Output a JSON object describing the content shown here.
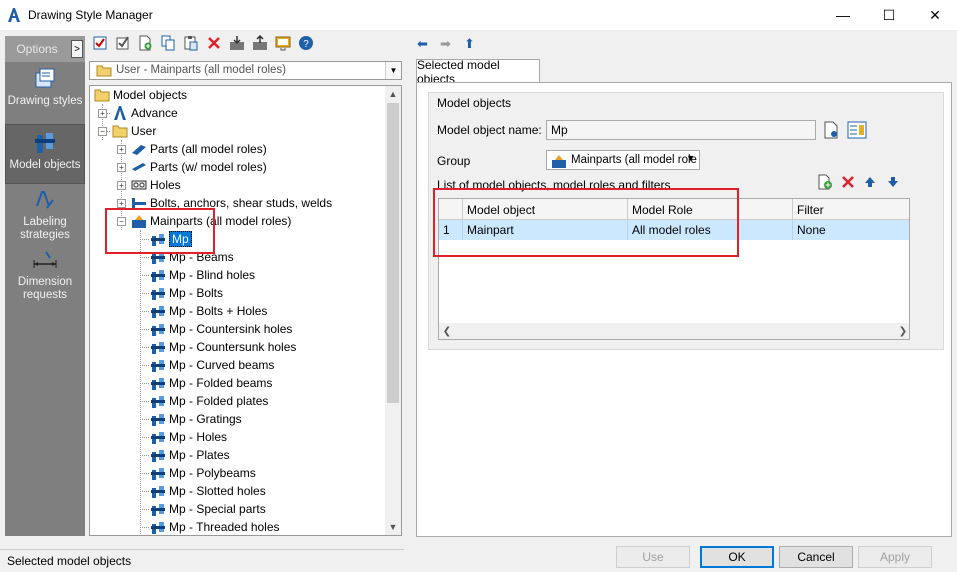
{
  "window": {
    "title": "Drawing Style Manager",
    "minimize": "—",
    "maximize": "☐",
    "close": "✕"
  },
  "nav": {
    "options_label": "Options",
    "expand_label": ">",
    "items": [
      {
        "label": "Drawing styles",
        "icon": "drawing-styles-icon"
      },
      {
        "label": "Model objects",
        "icon": "model-objects-icon"
      },
      {
        "label": "Labeling strategies",
        "icon": "labeling-strategies-icon"
      },
      {
        "label": "Dimension requests",
        "icon": "dimension-requests-icon"
      }
    ]
  },
  "toolbar": {
    "icons": [
      "check-icon",
      "check-edit-icon",
      "new-icon",
      "copy-icon",
      "paste-icon",
      "delete-icon",
      "import-icon",
      "export-icon",
      "properties-icon",
      "help-icon"
    ],
    "back": "⬅",
    "forward": "➡",
    "up": "⬆"
  },
  "folder_combo": {
    "value": "User - Mainparts (all model roles)"
  },
  "tree": {
    "root": "Model objects",
    "advance": "Advance",
    "user": "User",
    "user_children": [
      "Parts (all model roles)",
      "Parts (w/ model roles)",
      "Holes",
      "Bolts, anchors, shear studs, welds",
      "Mainparts (all model roles)"
    ],
    "mainparts_children": [
      "Mp",
      "Mp - Beams",
      "Mp - Blind holes",
      "Mp - Bolts",
      "Mp - Bolts + Holes",
      "Mp - Countersink holes",
      "Mp - Countersunk holes",
      "Mp - Curved beams",
      "Mp - Folded beams",
      "Mp - Folded plates",
      "Mp - Gratings",
      "Mp - Holes",
      "Mp - Plates",
      "Mp - Polybeams",
      "Mp - Slotted holes",
      "Mp - Special parts",
      "Mp - Threaded holes"
    ]
  },
  "right": {
    "tab_label": "Selected model objects",
    "group_title": "Model objects",
    "name_label": "Model object name:",
    "name_value": "Mp",
    "group_label": "Group",
    "group_value": "Mainparts (all model role",
    "list_label": "List of model objects, model roles and filters",
    "columns": [
      "Model object",
      "Model Role",
      "Filter"
    ],
    "rows": [
      {
        "index": "1",
        "model_object": "Mainpart",
        "model_role": "All model roles",
        "filter": "None"
      }
    ]
  },
  "status": {
    "text": "Selected model objects"
  },
  "buttons": {
    "use": "Use",
    "ok": "OK",
    "cancel": "Cancel",
    "apply": "Apply"
  },
  "colors": {
    "highlight": "#e0202a",
    "selection": "#0078d7",
    "row_selected": "#cce8ff",
    "nav_bg": "#7f7f7f"
  }
}
